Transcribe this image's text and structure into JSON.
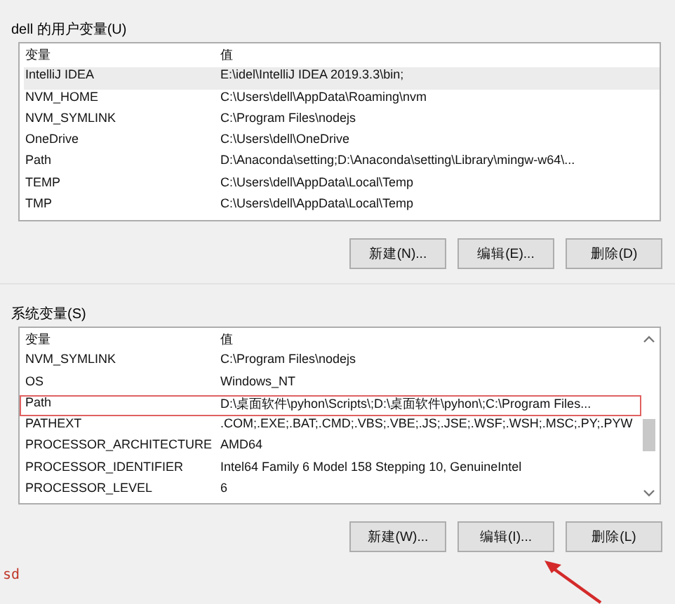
{
  "user_variables": {
    "title": "dell 的用户变量(U)",
    "columns": [
      "变量",
      "值"
    ],
    "rows": [
      {
        "name": "IntelliJ IDEA",
        "value": "E:\\idel\\IntelliJ IDEA 2019.3.3\\bin;",
        "selected": true,
        "marked": false
      },
      {
        "name": "NVM_HOME",
        "value": "C:\\Users\\dell\\AppData\\Roaming\\nvm",
        "selected": false,
        "marked": false
      },
      {
        "name": "NVM_SYMLINK",
        "value": "C:\\Program Files\\nodejs",
        "selected": false,
        "marked": false
      },
      {
        "name": "OneDrive",
        "value": "C:\\Users\\dell\\OneDrive",
        "selected": false,
        "marked": false
      },
      {
        "name": "Path",
        "value": "D:\\Anaconda\\setting;D:\\Anaconda\\setting\\Library\\mingw-w64\\...",
        "selected": false,
        "marked": false
      },
      {
        "name": "TEMP",
        "value": "C:\\Users\\dell\\AppData\\Local\\Temp",
        "selected": false,
        "marked": false
      },
      {
        "name": "TMP",
        "value": "C:\\Users\\dell\\AppData\\Local\\Temp",
        "selected": false,
        "marked": false
      }
    ],
    "buttons": [
      "新建(N)...",
      "编辑(E)...",
      "删除(D)"
    ]
  },
  "system_variables": {
    "title": "系统变量(S)",
    "columns": [
      "变量",
      "值"
    ],
    "rows": [
      {
        "name": "NVM_SYMLINK",
        "value": "C:\\Program Files\\nodejs",
        "selected": false,
        "marked": false
      },
      {
        "name": "OS",
        "value": "Windows_NT",
        "selected": false,
        "marked": false
      },
      {
        "name": "Path",
        "value": "D:\\桌面软件\\pyhon\\Scripts\\;D:\\桌面软件\\pyhon\\;C:\\Program Files...",
        "selected": false,
        "marked": true
      },
      {
        "name": "PATHEXT",
        "value": ".COM;.EXE;.BAT;.CMD;.VBS;.VBE;.JS;.JSE;.WSF;.WSH;.MSC;.PY;.PYW",
        "selected": false,
        "marked": false
      },
      {
        "name": "PROCESSOR_ARCHITECTURE",
        "value": "AMD64",
        "selected": false,
        "marked": false
      },
      {
        "name": "PROCESSOR_IDENTIFIER",
        "value": "Intel64 Family 6 Model 158 Stepping 10, GenuineIntel",
        "selected": false,
        "marked": false
      },
      {
        "name": "PROCESSOR_LEVEL",
        "value": "6",
        "selected": false,
        "marked": false
      }
    ],
    "buttons": [
      "新建(W)...",
      "编辑(I)...",
      "删除(L)"
    ]
  },
  "footer_note": "sd"
}
